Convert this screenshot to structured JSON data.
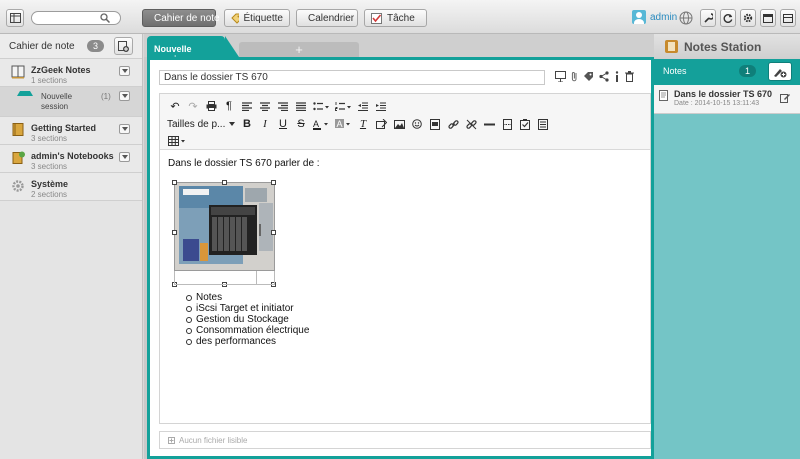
{
  "topbar": {
    "search_placeholder": "",
    "buttons": [
      {
        "label": "Cahier de note",
        "icon": "notebook-icon"
      },
      {
        "label": "Étiquette",
        "icon": "tag-icon"
      },
      {
        "label": "Calendrier",
        "icon": "calendar-icon"
      },
      {
        "label": "Tâche",
        "icon": "task-check-icon"
      }
    ],
    "user": "admin"
  },
  "sidebar": {
    "title": "Cahier de note",
    "count": "3",
    "notebooks": [
      {
        "name": "ZzGeek Notes",
        "sections": "1 sections"
      },
      {
        "name": "Getting Started",
        "sections": "3 sections"
      },
      {
        "name": "admin's Notebooks",
        "sections": "3 sections"
      },
      {
        "name": "Système",
        "sections": "2 sections"
      }
    ],
    "subsection": {
      "name": "Nouvelle session",
      "count": "(1)"
    }
  },
  "editor": {
    "tab_label": "Nouvelle session",
    "new_tab_label": "+",
    "note_title": "Dans le dossier TS 670",
    "font_size_label": "Tailles de p...",
    "content_line": "Dans le dossier TS 670 parler de :",
    "bullets": [
      " Notes",
      "iScsi Target et initiator",
      "Gestion du Stockage",
      "Consommation électrique",
      "des performances"
    ],
    "attachments_label": "Aucun fichier lisible"
  },
  "rightpanel": {
    "app_title": "Notes Station",
    "notes_label": "Notes",
    "notes_count": "1",
    "note": {
      "title": "Dans le dossier TS 670",
      "date": "Date : 2014-10-15 13:11:43"
    }
  },
  "colors": {
    "accent": "#13a19a",
    "panel": "#74c5c6",
    "user": "#2a8bbf"
  }
}
